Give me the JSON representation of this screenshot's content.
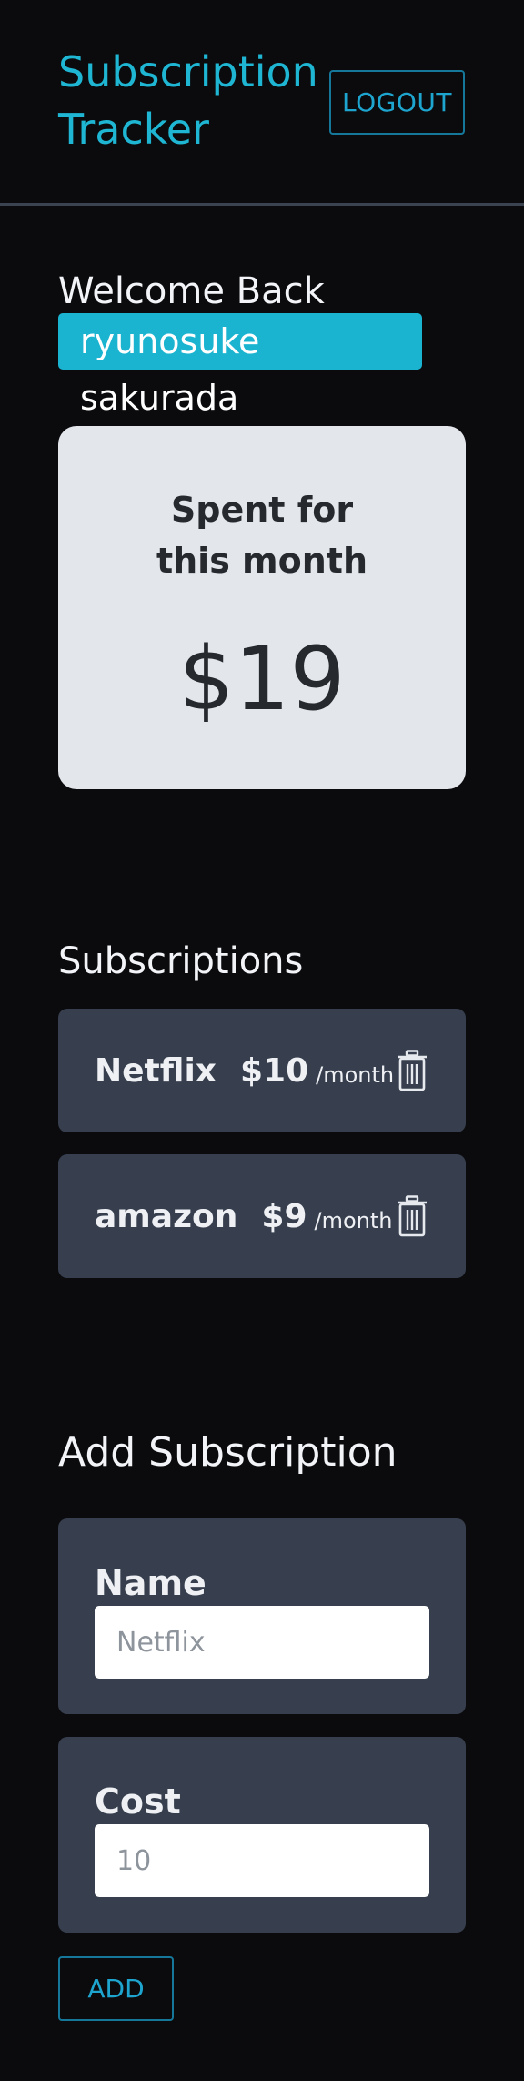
{
  "header": {
    "title": "Subscription Tracker",
    "logout_label": "LOGOUT"
  },
  "welcome": {
    "greeting": "Welcome Back",
    "username": "ryunosuke sakurada"
  },
  "spent": {
    "label": "Spent for this month",
    "amount": "$19"
  },
  "subscriptions": {
    "title": "Subscriptions",
    "items": [
      {
        "name": "Netflix",
        "cost": "$10",
        "period": "/month",
        "icon": "trash-icon"
      },
      {
        "name": "amazon",
        "cost": "$9",
        "period": "/month",
        "icon": "trash-icon"
      }
    ]
  },
  "add_form": {
    "title": "Add Subscription",
    "name_label": "Name",
    "name_placeholder": "Netflix",
    "name_value": "",
    "cost_label": "Cost",
    "cost_placeholder": "10",
    "cost_value": "",
    "submit_label": "ADD"
  },
  "colors": {
    "accent": "#1eb6d3",
    "background": "#0b0b0d",
    "card": "#373f4e",
    "summary_card": "#e3e6eb"
  }
}
